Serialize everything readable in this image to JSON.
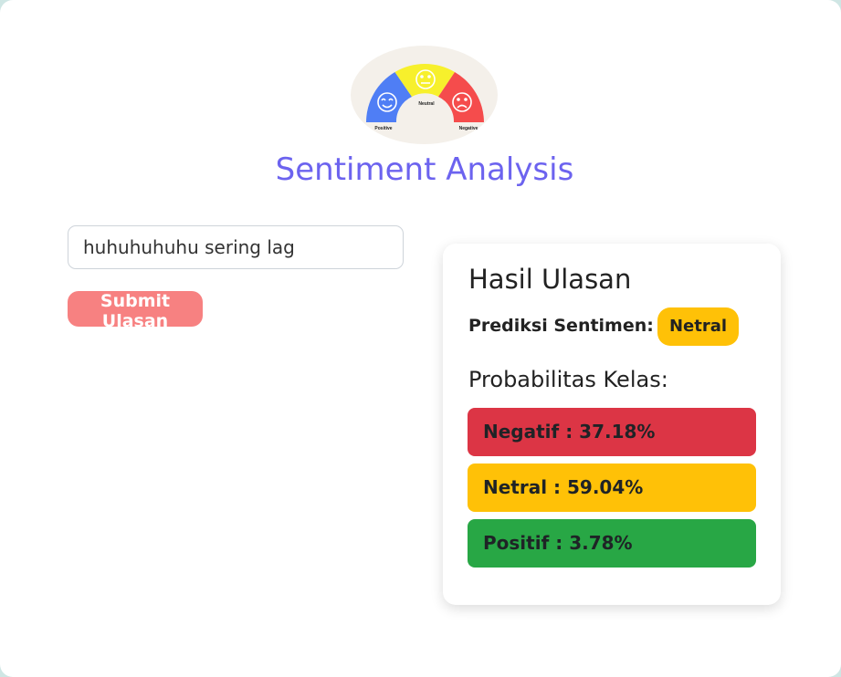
{
  "header": {
    "title": "Sentiment Analysis",
    "logo": {
      "icon_names": [
        "smile-face-icon",
        "neutral-face-icon",
        "sad-face-icon"
      ],
      "labels": {
        "positive": "Positive",
        "neutral": "Neutral",
        "negative": "Negative"
      },
      "colors": {
        "positive": "#4f7ef5",
        "neutral": "#f7f02c",
        "negative": "#f54c4c",
        "background": "#f4f0ea"
      }
    }
  },
  "form": {
    "review_value": "huhuhuhuhu sering lag",
    "submit_label": "Submit Ulasan",
    "submit_color": "#f78181"
  },
  "result": {
    "title": "Hasil Ulasan",
    "prediction_label": "Prediksi Sentimen:",
    "prediction_value": "Netral",
    "prediction_color": "#ffc107",
    "probabilities_title": "Probabilitas Kelas:",
    "probabilities": [
      {
        "text": "Negatif : 37.18%",
        "color": "#dc3545"
      },
      {
        "text": "Netral : 59.04%",
        "color": "#ffc107"
      },
      {
        "text": "Positif : 3.78%",
        "color": "#28a745"
      }
    ]
  },
  "accent_color": "#6c63ef"
}
